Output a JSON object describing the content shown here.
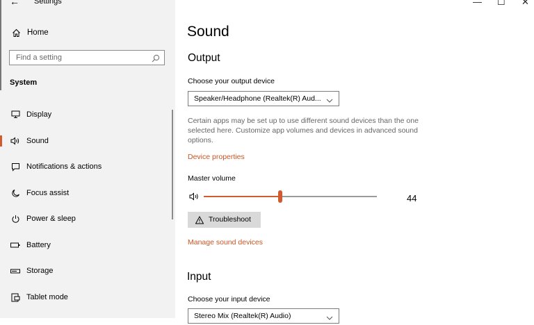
{
  "window": {
    "title": "Settings",
    "back_glyph": "←",
    "min_glyph": "—",
    "max_glyph": "☐",
    "close_glyph": "✕"
  },
  "sidebar": {
    "home_label": "Home",
    "search_placeholder": "Find a setting",
    "section": "System",
    "items": [
      {
        "label": "Display",
        "icon": "monitor-icon"
      },
      {
        "label": "Sound",
        "icon": "speaker-icon",
        "active": true
      },
      {
        "label": "Notifications & actions",
        "icon": "notification-icon"
      },
      {
        "label": "Focus assist",
        "icon": "moon-icon"
      },
      {
        "label": "Power & sleep",
        "icon": "power-icon"
      },
      {
        "label": "Battery",
        "icon": "battery-icon"
      },
      {
        "label": "Storage",
        "icon": "storage-icon"
      },
      {
        "label": "Tablet mode",
        "icon": "tablet-icon"
      }
    ]
  },
  "main": {
    "title": "Sound",
    "output": {
      "heading": "Output",
      "device_label": "Choose your output device",
      "device_value": "Speaker/Headphone (Realtek(R) Aud...",
      "description": "Certain apps may be set up to use different sound devices than the one selected here. Customize app volumes and devices in advanced sound options.",
      "device_properties": "Device properties",
      "master_volume_label": "Master volume",
      "volume": 44,
      "volume_text": "44",
      "troubleshoot": "Troubleshoot",
      "manage": "Manage sound devices"
    },
    "input": {
      "heading": "Input",
      "device_label": "Choose your input device",
      "device_value": "Stereo Mix (Realtek(R) Audio)"
    }
  },
  "colors": {
    "accent": "#d05b2f",
    "link": "#c85423"
  }
}
